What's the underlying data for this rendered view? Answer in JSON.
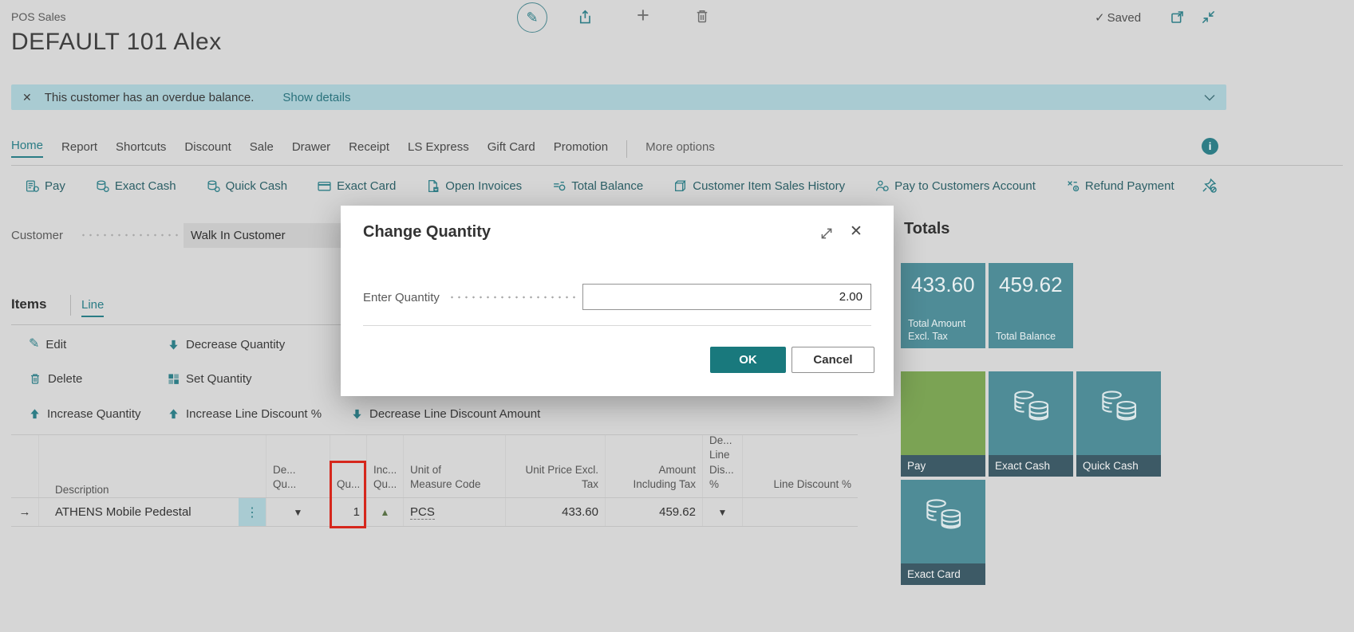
{
  "header": {
    "app_title": "POS Sales",
    "page_title": "DEFAULT 101 Alex",
    "saved": "Saved"
  },
  "icons": {
    "check": "✓",
    "close": "✕",
    "pencil": "✎",
    "plus": "+",
    "ellipsis": "⋮",
    "row_arrow": "→",
    "down_triangle": "▼",
    "up_triangle": "▲"
  },
  "notification": {
    "message": "This customer has an overdue balance.",
    "action": "Show details"
  },
  "nav": {
    "tabs": [
      "Home",
      "Report",
      "Shortcuts",
      "Discount",
      "Sale",
      "Drawer",
      "Receipt",
      "LS Express",
      "Gift Card",
      "Promotion"
    ],
    "more_options": "More options"
  },
  "actions_bar": {
    "items": [
      "Pay",
      "Exact Cash",
      "Quick Cash",
      "Exact Card",
      "Open Invoices",
      "Total Balance",
      "Customer Item Sales History",
      "Pay to Customers Account",
      "Refund Payment"
    ]
  },
  "customer": {
    "label": "Customer",
    "value": "Walk In Customer"
  },
  "lines_section": {
    "tab_items": "Items",
    "tab_line": "Line",
    "edit": "Edit",
    "delete": "Delete",
    "increase_quantity": "Increase Quantity",
    "decrease_quantity": "Decrease Quantity",
    "set_quantity": "Set Quantity",
    "increase_line_discount": "Increase Line Discount %",
    "decrease_line_discount": "Decrease Line Discount Amount"
  },
  "table": {
    "headers": {
      "description": "Description",
      "dec_qty": "De...\nQu...",
      "qty": "Qu...",
      "inc_qty": "Inc...\nQu...",
      "uom": "Unit of\nMeasure Code",
      "unit_price": "Unit Price Excl.\nTax",
      "amount": "Amount\nIncluding Tax",
      "dec_line_disc": "De...\nLine\nDis...\n%",
      "line_disc": "Line Discount %"
    },
    "row": {
      "description": "ATHENS Mobile Pedestal",
      "qty": "1",
      "uom": "PCS",
      "unit_price": "433.60",
      "amount": "459.62",
      "line_disc": ""
    }
  },
  "dialog": {
    "title": "Change Quantity",
    "field_label": "Enter Quantity",
    "field_value": "2.00",
    "ok": "OK",
    "cancel": "Cancel"
  },
  "totals": {
    "title": "Totals",
    "tiles": [
      {
        "value": "433.60",
        "label": "Total Amount Excl. Tax"
      },
      {
        "value": "459.62",
        "label": "Total Balance"
      }
    ],
    "payment_buttons": [
      "Pay",
      "Exact Cash",
      "Quick Cash",
      "Exact Card"
    ]
  },
  "colors": {
    "accent_teal": "#2e7d86",
    "tile_teal": "#4f8c97",
    "tile_green": "#7ba354",
    "tile_label_bar": "#3d5a66",
    "ok_button": "#19797d",
    "notification_bg": "#a9cbd2",
    "highlight_red": "#d6271c"
  }
}
